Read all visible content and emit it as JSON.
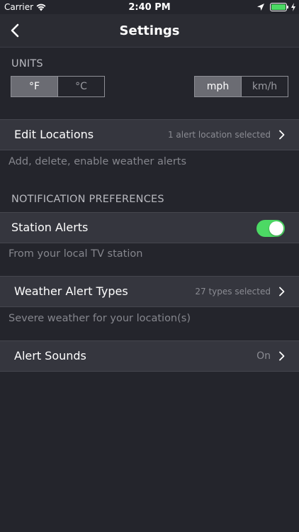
{
  "status_bar": {
    "carrier": "Carrier",
    "time": "2:40 PM",
    "icons": [
      "wifi-icon",
      "location-arrow-icon",
      "battery-icon",
      "charging-bolt-icon"
    ]
  },
  "nav": {
    "title": "Settings",
    "back_icon": "chevron-left-icon"
  },
  "units": {
    "header": "UNITS",
    "temperature": {
      "options": [
        "°F",
        "°C"
      ],
      "selected": "°F"
    },
    "speed": {
      "options": [
        "mph",
        "km/h"
      ],
      "selected": "mph"
    }
  },
  "edit_locations": {
    "label": "Edit Locations",
    "value": "1 alert location selected",
    "caption": "Add, delete, enable weather alerts"
  },
  "notification_preferences": {
    "header": "NOTIFICATION PREFERENCES",
    "station_alerts": {
      "label": "Station Alerts",
      "enabled": true,
      "caption": "From your local TV station"
    },
    "weather_alert_types": {
      "label": "Weather Alert Types",
      "value": "27 types selected",
      "caption": "Severe weather for your location(s)"
    },
    "alert_sounds": {
      "label": "Alert Sounds",
      "value": "On"
    }
  },
  "colors": {
    "background": "#24252c",
    "row": "#35363e",
    "toggle_on": "#4cd964",
    "segment_active": "#6b6c73"
  }
}
